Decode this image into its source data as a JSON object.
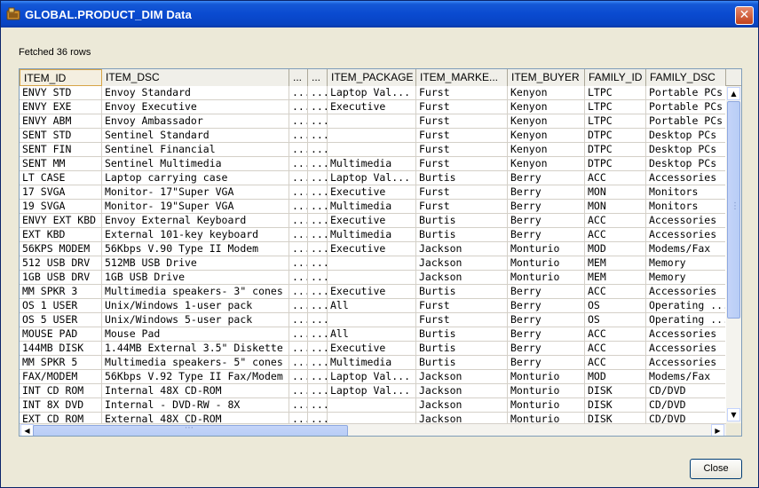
{
  "window": {
    "title": "GLOBAL.PRODUCT_DIM Data",
    "close_glyph": "✕"
  },
  "status_text": "Fetched 36 rows",
  "columns": [
    "ITEM_ID",
    "ITEM_DSC",
    "...",
    "...",
    "ITEM_PACKAGE",
    "ITEM_MARKE...",
    "ITEM_BUYER",
    "FAMILY_ID",
    "FAMILY_DSC"
  ],
  "rows": [
    [
      "ENVY STD",
      "Envoy Standard",
      "...",
      "...",
      "Laptop Val...",
      "Furst",
      "Kenyon",
      "LTPC",
      "Portable PCs"
    ],
    [
      "ENVY EXE",
      "Envoy Executive",
      "...",
      "...",
      "Executive",
      "Furst",
      "Kenyon",
      "LTPC",
      "Portable PCs"
    ],
    [
      "ENVY ABM",
      "Envoy Ambassador",
      "...",
      "...",
      "",
      "Furst",
      "Kenyon",
      "LTPC",
      "Portable PCs"
    ],
    [
      "SENT STD",
      "Sentinel Standard",
      "...",
      "...",
      "",
      "Furst",
      "Kenyon",
      "DTPC",
      "Desktop PCs"
    ],
    [
      "SENT FIN",
      "Sentinel Financial",
      "...",
      "...",
      "",
      "Furst",
      "Kenyon",
      "DTPC",
      "Desktop PCs"
    ],
    [
      "SENT MM",
      "Sentinel Multimedia",
      "...",
      "...",
      "Multimedia",
      "Furst",
      "Kenyon",
      "DTPC",
      "Desktop PCs"
    ],
    [
      "LT CASE",
      "Laptop carrying case",
      "...",
      "...",
      "Laptop Val...",
      "Burtis",
      "Berry",
      "ACC",
      "Accessories"
    ],
    [
      "17 SVGA",
      "Monitor- 17\"Super VGA",
      "...",
      "...",
      "Executive",
      "Furst",
      "Berry",
      "MON",
      "Monitors"
    ],
    [
      "19 SVGA",
      "Monitor- 19\"Super VGA",
      "...",
      "...",
      "Multimedia",
      "Furst",
      "Berry",
      "MON",
      "Monitors"
    ],
    [
      "ENVY EXT KBD",
      "Envoy External Keyboard",
      "...",
      "...",
      "Executive",
      "Burtis",
      "Berry",
      "ACC",
      "Accessories"
    ],
    [
      "EXT KBD",
      "External 101-key keyboard",
      "...",
      "...",
      "Multimedia",
      "Burtis",
      "Berry",
      "ACC",
      "Accessories"
    ],
    [
      "56KPS MODEM",
      "56Kbps V.90 Type II Modem",
      "...",
      "...",
      "Executive",
      "Jackson",
      "Monturio",
      "MOD",
      "Modems/Fax"
    ],
    [
      "512 USB DRV",
      "512MB USB Drive",
      "...",
      "...",
      "",
      "Jackson",
      "Monturio",
      "MEM",
      "Memory"
    ],
    [
      "1GB USB DRV",
      "1GB USB Drive",
      "...",
      "...",
      "",
      "Jackson",
      "Monturio",
      "MEM",
      "Memory"
    ],
    [
      "MM SPKR 3",
      "Multimedia speakers- 3\" cones",
      "...",
      "...",
      "Executive",
      "Burtis",
      "Berry",
      "ACC",
      "Accessories"
    ],
    [
      "OS 1 USER",
      "Unix/Windows 1-user pack",
      "...",
      "...",
      "All",
      "Furst",
      "Berry",
      "OS",
      "Operating ..."
    ],
    [
      "OS 5 USER",
      "Unix/Windows 5-user pack",
      "...",
      "...",
      "",
      "Furst",
      "Berry",
      "OS",
      "Operating ..."
    ],
    [
      "MOUSE PAD",
      "Mouse Pad",
      "...",
      "...",
      "All",
      "Burtis",
      "Berry",
      "ACC",
      "Accessories"
    ],
    [
      "144MB DISK",
      "1.44MB External 3.5\" Diskette",
      "...",
      "...",
      "Executive",
      "Burtis",
      "Berry",
      "ACC",
      "Accessories"
    ],
    [
      "MM SPKR 5",
      "Multimedia speakers- 5\" cones",
      "...",
      "...",
      "Multimedia",
      "Burtis",
      "Berry",
      "ACC",
      "Accessories"
    ],
    [
      "FAX/MODEM",
      "56Kbps V.92 Type II Fax/Modem",
      "...",
      "...",
      "Laptop Val...",
      "Jackson",
      "Monturio",
      "MOD",
      "Modems/Fax"
    ],
    [
      "INT CD ROM",
      "Internal 48X CD-ROM",
      "...",
      "...",
      "Laptop Val...",
      "Jackson",
      "Monturio",
      "DISK",
      "CD/DVD"
    ],
    [
      "INT 8X DVD",
      "Internal - DVD-RW - 8X",
      "...",
      "...",
      "",
      "Jackson",
      "Monturio",
      "DISK",
      "CD/DVD"
    ],
    [
      "EXT CD ROM",
      "External 48X CD-ROM",
      "...",
      "...",
      "",
      "Jackson",
      "Monturio",
      "DISK",
      "CD/DVD"
    ]
  ],
  "scroll": {
    "up": "▲",
    "down": "▼",
    "left": "◀",
    "right": "▶",
    "vertical_grip": "⋮",
    "horizontal_grip": "⋯"
  },
  "buttons": {
    "close": "Close"
  }
}
